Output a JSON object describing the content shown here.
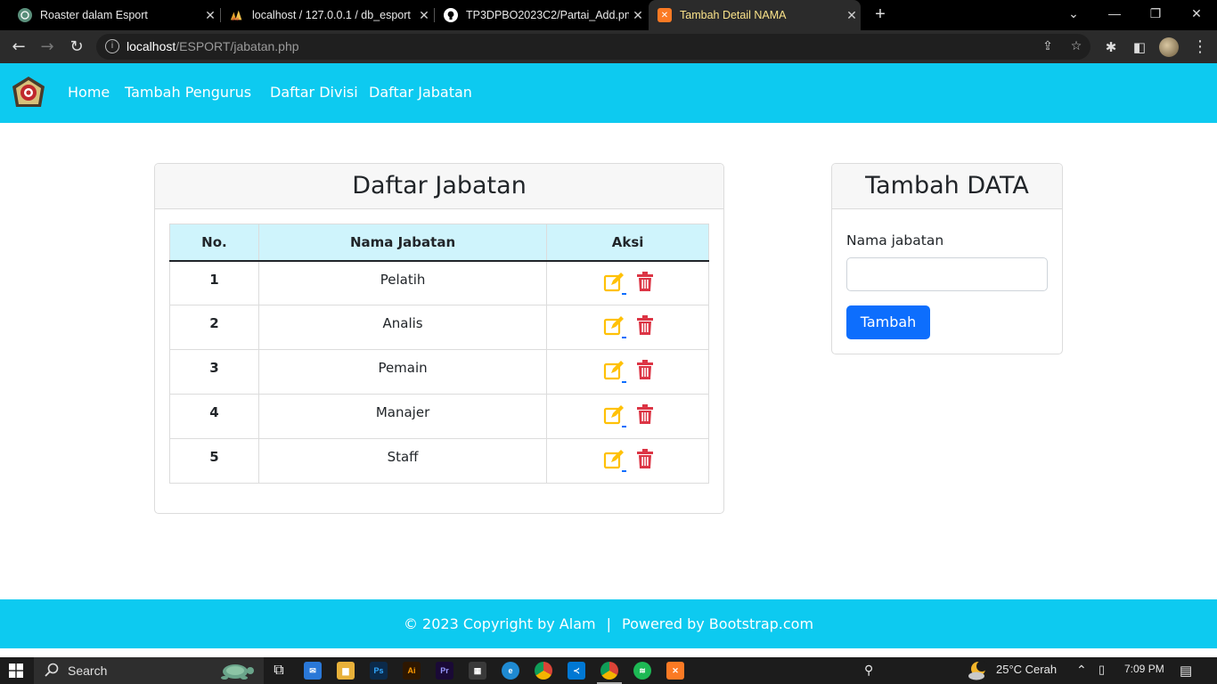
{
  "browser": {
    "tabs": [
      {
        "title": "Roaster dalam Esport",
        "icon": "chatgpt-icon"
      },
      {
        "title": "localhost / 127.0.0.1 / db_esport",
        "icon": "phpmyadmin-icon"
      },
      {
        "title": "TP3DPBO2023C2/Partai_Add.png",
        "icon": "github-icon"
      },
      {
        "title": "Tambah Detail NAMA",
        "icon": "xampp-icon"
      }
    ],
    "url_host": "localhost",
    "url_path": "/ESPORT/jabatan.php"
  },
  "navbar": {
    "links": [
      "Home",
      "Tambah Pengurus",
      "Daftar Divisi",
      "Daftar Jabatan"
    ]
  },
  "list_card": {
    "title": "Daftar Jabatan",
    "headers": {
      "no": "No.",
      "name": "Nama Jabatan",
      "action": "Aksi"
    },
    "rows": [
      {
        "no": "1",
        "name": "Pelatih"
      },
      {
        "no": "2",
        "name": "Analis"
      },
      {
        "no": "3",
        "name": "Pemain"
      },
      {
        "no": "4",
        "name": "Manajer"
      },
      {
        "no": "5",
        "name": "Staff"
      }
    ]
  },
  "form_card": {
    "title": "Tambah DATA",
    "label": "Nama jabatan",
    "input_value": "",
    "button": "Tambah"
  },
  "footer": {
    "copyright": "© 2023 Copyright by Alam",
    "separator": "|",
    "powered": "Powered by Bootstrap.com"
  },
  "taskbar": {
    "search_label": "Search",
    "weather": "25°C  Cerah",
    "time": "7:09 PM"
  },
  "colors": {
    "navbar": "#0dcaf0",
    "primary": "#0d6efd",
    "edit_icon": "#ffc107",
    "delete_icon": "#dc3545",
    "table_header": "#cff4fc"
  }
}
